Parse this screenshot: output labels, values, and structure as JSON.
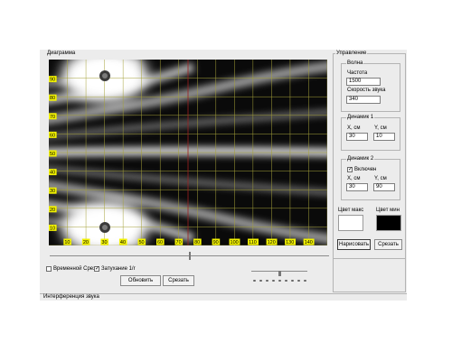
{
  "diagram": {
    "title": "Диаграмма",
    "y_ticks": [
      "90",
      "80",
      "70",
      "60",
      "50",
      "40",
      "30",
      "20",
      "10"
    ],
    "x_ticks": [
      "10",
      "20",
      "30",
      "40",
      "50",
      "60",
      "70",
      "80",
      "90",
      "100",
      "110",
      "120",
      "130",
      "140"
    ]
  },
  "controls": {
    "title": "Управление",
    "wave": {
      "title": "Волна",
      "freq_label": "Частота",
      "freq_value": "1500",
      "speed_label": "Скорость звука",
      "speed_value": "340"
    },
    "speaker1": {
      "title": "Динамик 1",
      "x_label": "X, см",
      "x_value": "30",
      "y_label": "Y, см",
      "y_value": "10"
    },
    "speaker2": {
      "title": "Динамик 2",
      "enabled_label": "Включен",
      "x_label": "X, см",
      "x_value": "30",
      "y_label": "Y, см",
      "y_value": "90"
    },
    "color_max_label": "Цвет макс",
    "color_min_label": "Цвет мин",
    "color_max": "#ffffff",
    "color_min": "#000000",
    "draw_button": "Нарисовать",
    "cut_button": "Срезать"
  },
  "bottom": {
    "time_cut_label": "Временной Срез",
    "decay_label": "Затухание 1/r",
    "update_button": "Обновить",
    "cut_button": "Срезать"
  },
  "status": {
    "text": "Интерференция звука"
  }
}
